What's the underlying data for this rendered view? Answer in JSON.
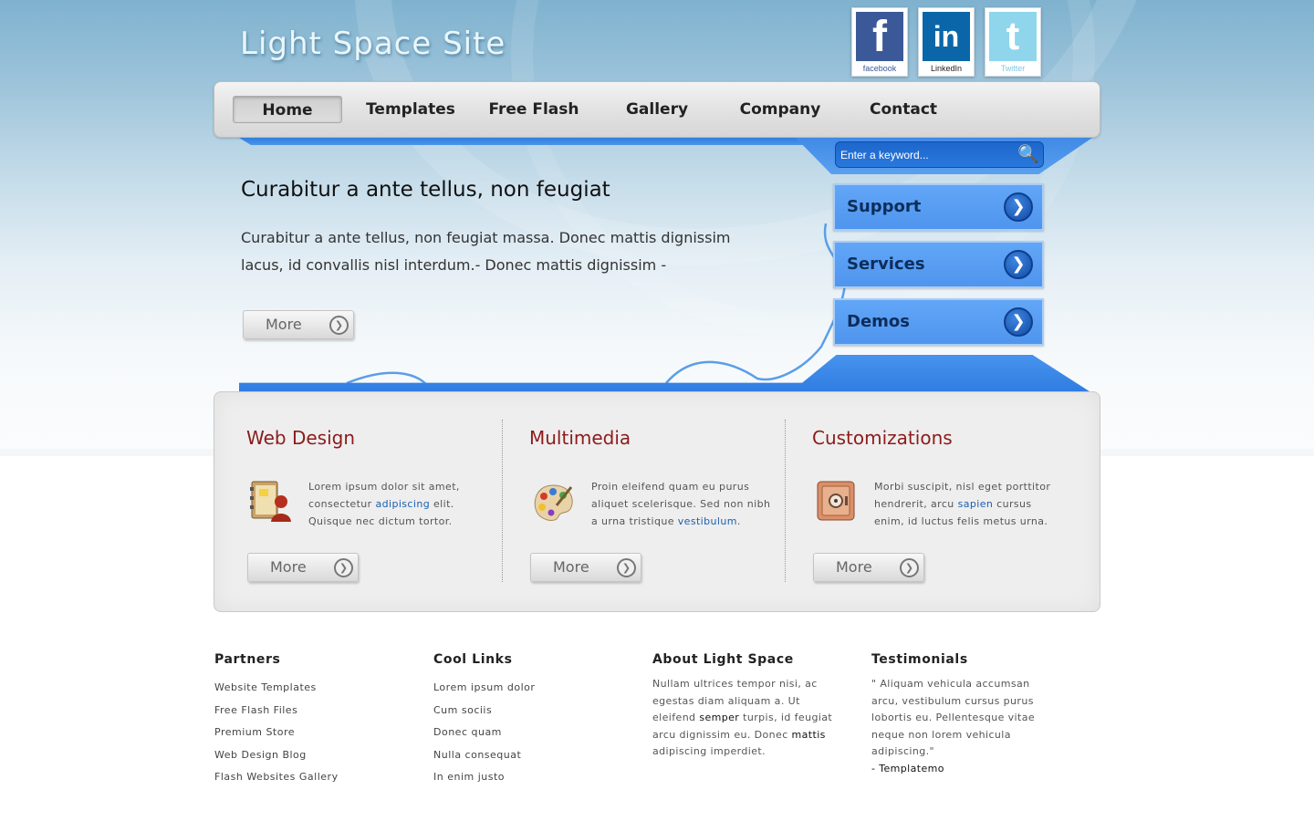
{
  "site": {
    "title": "Light Space Site"
  },
  "social": [
    {
      "name": "facebook",
      "glyph": "f",
      "caption": "facebook"
    },
    {
      "name": "linkedin",
      "glyph": "in",
      "caption": "LinkedIn"
    },
    {
      "name": "twitter",
      "glyph": "t",
      "caption": "Twitter"
    }
  ],
  "nav": {
    "items": [
      {
        "label": "Home",
        "active": true
      },
      {
        "label": "Templates"
      },
      {
        "label": "Free Flash"
      },
      {
        "label": "Gallery"
      },
      {
        "label": "Company"
      },
      {
        "label": "Contact"
      }
    ]
  },
  "search": {
    "placeholder": "Enter a keyword...",
    "icon": "magnifier-icon"
  },
  "hero": {
    "title": "Curabitur a ante tellus, non feugiat",
    "text": "Curabitur a ante tellus, non feugiat massa. Donec mattis dignissim lacus, id convallis nisl interdum.- Donec mattis dignissim -",
    "more_label": "More"
  },
  "side_buttons": [
    {
      "label": "Support"
    },
    {
      "label": "Services"
    },
    {
      "label": "Demos"
    }
  ],
  "features": [
    {
      "title": "Web Design",
      "icon": "contacts-book-icon",
      "text_before": "Lorem ipsum dolor sit amet, consectetur ",
      "link": "adipiscing",
      "text_after": " elit. Quisque nec dictum tortor.",
      "more_label": "More"
    },
    {
      "title": "Multimedia",
      "icon": "palette-icon",
      "text_before": "Proin eleifend quam eu purus aliquet scelerisque. Sed non nibh a urna tristique ",
      "link": "vestibulum",
      "text_after": ".",
      "more_label": "More"
    },
    {
      "title": "Customizations",
      "icon": "safe-icon",
      "text_before": "Morbi suscipit, nisl eget porttitor hendrerit, arcu ",
      "link": "sapien",
      "text_after": " cursus enim, id luctus felis metus urna.",
      "more_label": "More"
    }
  ],
  "footer": {
    "partners": {
      "title": "Partners",
      "items": [
        "Website Templates",
        "Free Flash Files",
        "Premium Store",
        "Web Design Blog",
        "Flash Websites Gallery"
      ]
    },
    "cool_links": {
      "title": "Cool Links",
      "items": [
        "Lorem ipsum dolor",
        "Cum sociis",
        "Donec quam",
        "Nulla consequat",
        "In enim justo"
      ]
    },
    "about": {
      "title": "About Light Space",
      "text_1": "Nullam ultrices tempor nisi, ac egestas diam aliquam a. Ut eleifend ",
      "bold_1": "semper",
      "text_2": " turpis, id feugiat arcu dignissim eu. Donec ",
      "bold_2": "mattis",
      "text_3": " adipiscing imperdiet."
    },
    "testimonials": {
      "title": "Testimonials",
      "quote": "\" Aliquam vehicula accumsan arcu, vestibulum cursus purus lobortis eu. Pellentesque vitae neque non lorem vehicula adipiscing.\"",
      "author": "- Templatemo"
    }
  }
}
